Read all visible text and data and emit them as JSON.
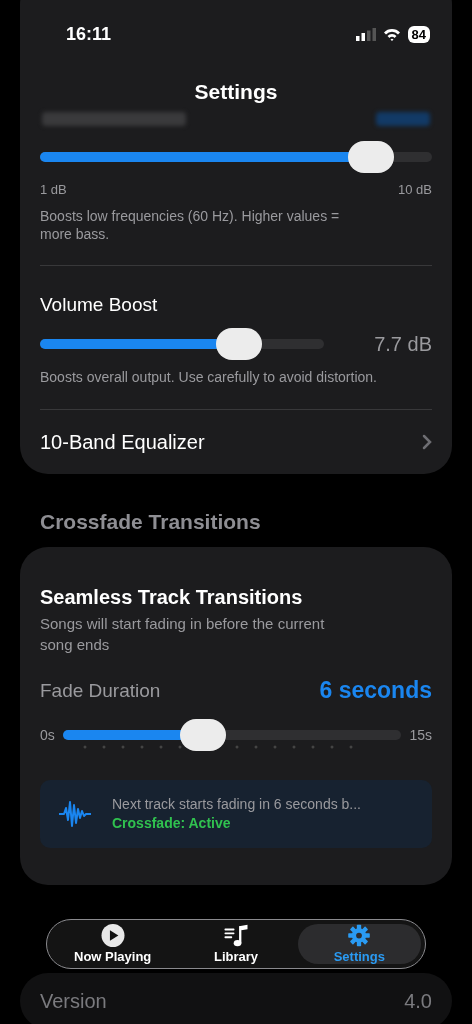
{
  "status_bar": {
    "time": "16:11",
    "battery": "84"
  },
  "header": {
    "title": "Settings"
  },
  "audio_card": {
    "bass_level": {
      "level": 0.89,
      "min": "1 dB",
      "max": "10 dB",
      "note": "Boosts low frequencies (60 Hz). Higher values = more bass."
    },
    "volume_boost": {
      "label": "Volume Boost",
      "reading": "7.7 dB",
      "level": 0.74,
      "note": "Boosts overall output. Use carefully to avoid distortion."
    },
    "equalizer": {
      "label": "10-Band Equalizer"
    }
  },
  "crossfade": {
    "section_title": "Crossfade Transitions",
    "title": "Seamless Track Transitions",
    "subtitle": "Songs will start fading in before the current song ends",
    "fade_label": "Fade Duration",
    "fade_reading": "6 seconds",
    "min": "0s",
    "max": "15s",
    "level": 0.4,
    "info": {
      "text": "Next track starts fading in 6 seconds b...",
      "status": "Crossfade: Active"
    }
  },
  "about": {
    "version_label": "Version",
    "version": "4.0"
  },
  "tabs": [
    {
      "label": "Now Playing",
      "selected": false
    },
    {
      "label": "Library",
      "selected": false
    },
    {
      "label": "Settings",
      "selected": true
    }
  ]
}
